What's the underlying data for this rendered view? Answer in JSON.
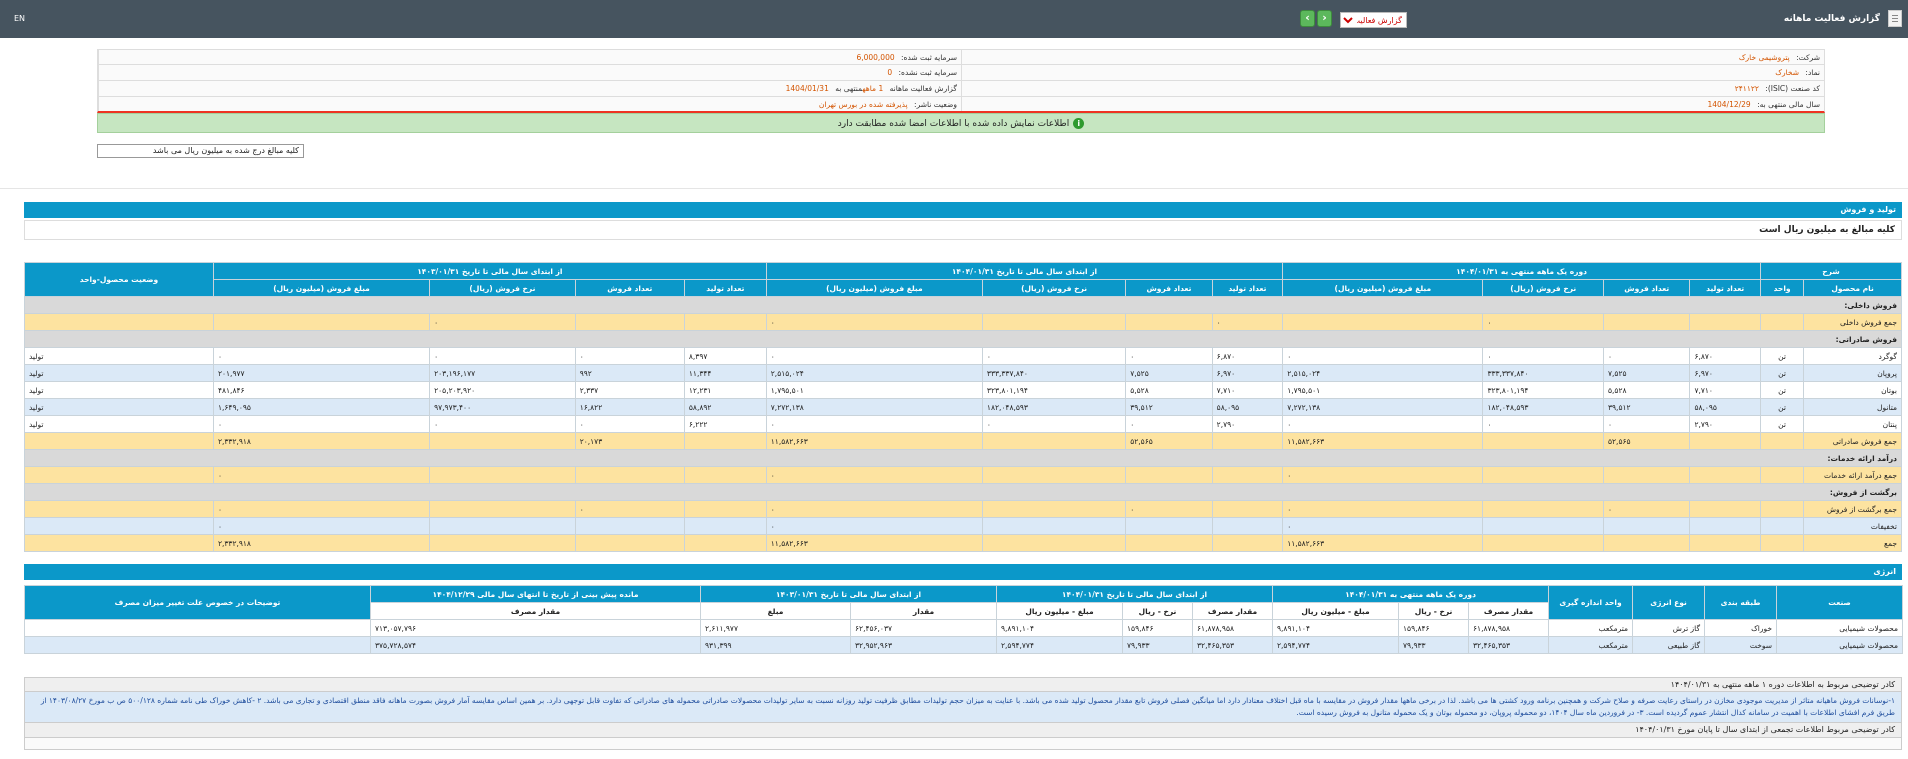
{
  "header": {
    "title": "گزارش فعالیت ماهانه",
    "report_type": "گزارش فعالیت",
    "lang": "EN",
    "next_symbol": "›",
    "prev_symbol": "‹"
  },
  "info": {
    "company_label": "شرکت:",
    "company_value": "پتروشیمی خارک",
    "registered_capital_label": "سرمایه ثبت شده:",
    "registered_capital_value": "6,000,000",
    "symbol_label": "نماد:",
    "symbol_value": "شخارک",
    "unregistered_capital_label": "سرمایه ثبت نشده:",
    "unregistered_capital_value": "0",
    "isic_label": "کد صنعت (ISIC):",
    "isic_value": "۲۴۱۱۲۲",
    "report_label": "گزارش فعالیت ماهانه",
    "report_value_mid": "1 ماهه",
    "report_value_tail": "منتهی به",
    "report_date": "1404/01/31",
    "fiscal_year_label": "سال مالی منتهی به:",
    "fiscal_year_value": "1404/12/29",
    "publisher_status_label": "وضعیت ناشر:",
    "publisher_status_value": "پذیرفته شده در بورس تهران",
    "notice": "اطلاعات نمایش داده شده با اطلاعات امضا شده مطابقت دارد",
    "amount_note": "کلیه مبالغ درج شده به میلیون ریال می باشد"
  },
  "production": {
    "section_title": "تولید و فروش",
    "amount_note": "کلیه مبالغ به میلیون ریال است",
    "group_headers": {
      "desc": "شرح",
      "period": "دوره یک ماهه منتهی به ۱۴۰۴/۰۱/۳۱",
      "ytd_current": "از ابتدای سال مالی تا تاریخ ۱۴۰۴/۰۱/۳۱",
      "ytd_prev": "از ابتدای سال مالی تا تاریخ ۱۴۰۳/۰۱/۳۱",
      "status": "وضعیت محصول-واحد"
    },
    "col_headers": {
      "product": "نام محصول",
      "unit": "واحد",
      "prod_qty": "تعداد تولید",
      "sale_qty": "تعداد فروش",
      "sale_rate": "نرخ فروش (ریال)",
      "sale_amount": "مبلغ فروش (میلیون ریال)"
    },
    "rows": [
      {
        "type": "grey",
        "name": "فروش داخلی:"
      },
      {
        "type": "yellow",
        "name": "جمع فروش داخلی",
        "v": [
          "",
          "",
          "۰",
          "",
          "۰",
          "",
          "",
          "۰",
          "",
          "",
          "۰",
          "",
          "۰"
        ],
        "status": ""
      },
      {
        "type": "grey",
        "name": "فروش صادراتی:"
      },
      {
        "type": "white",
        "name": "گوگرد",
        "unit": "تن",
        "v": [
          "۶,۸۷۰",
          "۰",
          "۰",
          "۰",
          "۶,۸۷۰",
          "۰",
          "۰",
          "۰",
          "۸,۳۹۷",
          "۰",
          "۰",
          "۰"
        ],
        "status": "تولید"
      },
      {
        "type": "blue",
        "name": "پروپان",
        "unit": "تن",
        "v": [
          "۶,۹۷۰",
          "۷,۵۲۵",
          "۳۳۳,۳۳۷,۸۴۰",
          "۲,۵۱۵,۰۲۴",
          "۶,۹۷۰",
          "۷,۵۲۵",
          "۳۳۳,۳۳۷,۸۴۰",
          "۲,۵۱۵,۰۲۴",
          "۱۱,۳۴۴",
          "۹۹۲",
          "۲۰۳,۱۹۶,۱۷۷",
          "۲۰۱,۹۷۷"
        ],
        "status": "تولید"
      },
      {
        "type": "white",
        "name": "بوتان",
        "unit": "تن",
        "v": [
          "۷,۷۱۰",
          "۵,۵۲۸",
          "۳۲۳,۸۰۱,۱۹۴",
          "۱,۷۹۵,۵۰۱",
          "۷,۷۱۰",
          "۵,۵۲۸",
          "۳۲۳,۸۰۱,۱۹۴",
          "۱,۷۹۵,۵۰۱",
          "۱۲,۲۳۱",
          "۲,۳۳۷",
          "۲۰۵,۲۰۳,۹۲۰",
          "۴۸۱,۸۴۶"
        ],
        "status": "تولید"
      },
      {
        "type": "blue",
        "name": "متانول",
        "unit": "تن",
        "v": [
          "۵۸,۰۹۵",
          "۳۹,۵۱۲",
          "۱۸۲,۰۴۸,۵۹۳",
          "۷,۲۷۲,۱۳۸",
          "۵۸,۰۹۵",
          "۳۹,۵۱۲",
          "۱۸۲,۰۴۸,۵۹۳",
          "۷,۲۷۲,۱۳۸",
          "۵۸,۸۹۲",
          "۱۶,۸۲۲",
          "۹۷,۹۷۳,۴۰۰",
          "۱,۶۴۹,۰۹۵"
        ],
        "status": "تولید"
      },
      {
        "type": "white",
        "name": "پنتان",
        "unit": "تن",
        "v": [
          "۲,۷۹۰",
          "۰",
          "۰",
          "۰",
          "۲,۷۹۰",
          "۰",
          "۰",
          "۰",
          "۶,۲۲۲",
          "۰",
          "۰",
          "۰"
        ],
        "status": "تولید"
      },
      {
        "type": "yellow",
        "name": "جمع فروش صادراتی",
        "v": [
          "",
          "۵۲,۵۶۵",
          "",
          "۱۱,۵۸۲,۶۶۳",
          "",
          "۵۲,۵۶۵",
          "",
          "۱۱,۵۸۲,۶۶۳",
          "",
          "۲۰,۱۷۳",
          "",
          "۲,۳۳۲,۹۱۸"
        ],
        "status": ""
      },
      {
        "type": "grey",
        "name": "درآمد ارائه خدمات:"
      },
      {
        "type": "yellow",
        "name": "جمع درآمد ارائه خدمات",
        "v": [
          "",
          "",
          "",
          "۰",
          "",
          "",
          "",
          "۰",
          "",
          "",
          "",
          "۰"
        ],
        "status": ""
      },
      {
        "type": "grey",
        "name": "برگشت از فروش:"
      },
      {
        "type": "yellow",
        "name": "جمع برگشت از فروش",
        "v": [
          "",
          "۰",
          "",
          "۰",
          "",
          "۰",
          "",
          "۰",
          "",
          "۰",
          "",
          "۰"
        ],
        "status": ""
      },
      {
        "type": "blue",
        "name": "تخفیفات",
        "v": [
          "",
          "",
          "",
          "۰",
          "",
          "",
          "",
          "۰",
          "",
          "",
          "",
          "۰"
        ],
        "status": ""
      },
      {
        "type": "yellow",
        "name": "جمع",
        "v": [
          "",
          "",
          "",
          "۱۱,۵۸۲,۶۶۳",
          "",
          "",
          "",
          "۱۱,۵۸۲,۶۶۳",
          "",
          "",
          "",
          "۲,۳۳۲,۹۱۸"
        ],
        "status": ""
      }
    ]
  },
  "energy": {
    "section_title": "انرژی",
    "group_headers": {
      "industry": "صنعت",
      "category": "طبقه بندی",
      "energy_type": "نوع انرژی",
      "unit": "واحد اندازه گیری",
      "period": "دوره یک ماهه منتهی به ۱۴۰۴/۰۱/۳۱",
      "ytd_current": "از ابتدای سال مالی تا تاریخ ۱۴۰۴/۰۱/۳۱",
      "ytd_prev": "از ابتدای سال مالی تا تاریخ ۱۴۰۳/۰۱/۳۱",
      "remaining": "مانده پیش بینی از تاریخ تا انتهای سال مالی ۱۴۰۴/۱۲/۲۹",
      "explain": "توضیحات در خصوص علت تغییر میزان مصرف"
    },
    "col_headers": {
      "consumption": "مقدار مصرف",
      "rate": "نرخ - ریال",
      "amount_m": "مبلغ - میلیون ریال",
      "qty": "مقدار",
      "amount": "مبلغ"
    },
    "rows": [
      {
        "industry": "محصولات شیمیایی",
        "category": "خوراک",
        "energy_type": "گاز ترش",
        "unit": "مترمکعب",
        "v": [
          "۶۱,۸۷۸,۹۵۸",
          "۱۵۹,۸۴۶",
          "۹,۸۹۱,۱۰۴",
          "۶۱,۸۷۸,۹۵۸",
          "۱۵۹,۸۴۶",
          "۹,۸۹۱,۱۰۴",
          "۶۲,۴۵۶,۰۳۷",
          "۲,۶۱۱,۹۷۷",
          "۷۱۳,۰۵۷,۷۹۶"
        ],
        "explain": ""
      },
      {
        "industry": "محصولات شیمیایی",
        "category": "سوخت",
        "energy_type": "گاز طبیعی",
        "unit": "مترمکعب",
        "v": [
          "۳۲,۴۶۵,۳۵۳",
          "۷۹,۹۳۳",
          "۲,۵۹۴,۷۷۴",
          "۳۲,۴۶۵,۳۵۳",
          "۷۹,۹۳۳",
          "۲,۵۹۴,۷۷۴",
          "۳۲,۹۵۲,۹۶۳",
          "۹۳۱,۳۹۹",
          "۳۷۵,۷۲۸,۵۷۴"
        ],
        "explain": ""
      }
    ]
  },
  "description": {
    "period_title": "کادر توضیحی مربوط به اطلاعات دوره ۱ ماهه منتهی به ۱۴۰۴/۰۱/۳۱",
    "period_text": "۱-نوسانات فروش ماهیانه متاثر از مدیریت موجودی مخازن در راستای رعایت صرفه و صلاح شرکت و همچنین برنامه ورود کشتی ها می باشد. لذا در برخی ماهها مقدار فروش در مقایسه با ماه قبل اختلاف معنادار دارد اما میانگین فصلی فروش تابع مقدار محصول تولید شده می باشد. با عنایت به میزان حجم تولیدات مطابق ظرفیت تولید روزانه نسبت به سایر تولیدات محصولات صادراتی محموله های صادراتی که تفاوت قابل توجهی دارد. بر همین اساس مقایسه آمار فروش بصورت ماهانه فاقد منطق اقتصادی و تجاری می باشد. ۲ -کاهش خوراک طی نامه شماره ۵۰۰/۱۲۸ ص ب مورخ ۱۴۰۳/۰۸/۲۷ از طریق فرم افشای اطلاعات با اهمیت در سامانه کدال انتشار عموم گردیده است. ۳- در فروردین ماه سال ۱۴۰۴، دو محموله پروپان، دو محموله بوتان و یک محموله متانول به فروش رسیده است.",
    "cumulative_title": "کادر توضیحی مربوط اطلاعات تجمعی از ابتدای سال تا پایان مورخ ۱۴۰۴/۰۱/۳۱"
  }
}
